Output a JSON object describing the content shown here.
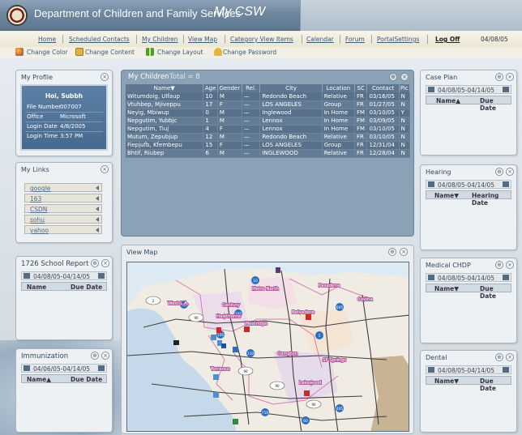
{
  "header": {
    "department": "Department of Children and Family Services",
    "app": "My CSW"
  },
  "nav": {
    "items": [
      "Home",
      "Scheduled Contacts",
      "My Children",
      "View Map",
      "Category View Items",
      "Calendar",
      "Forum",
      "PortalSettings",
      "Log Off"
    ],
    "date": "04/08/05"
  },
  "subnav": {
    "items": [
      "Change Color",
      "Change Content",
      "Change Layout",
      "Change Password"
    ]
  },
  "profile": {
    "title": "My Profile",
    "name": "Hoi, Subbh",
    "labels": [
      "File Number",
      "Office",
      "Login Date",
      "Login Time"
    ],
    "values": [
      "007007",
      "Microsoft",
      "4/8/2005",
      "3:57 PM"
    ]
  },
  "links": {
    "title": "My Links",
    "items": [
      "google",
      "163",
      "CSDN",
      "sohu",
      "yahoo"
    ]
  },
  "school_report": {
    "title": "1726 School Report",
    "range": "04/08/05-04/14/05",
    "col1": "Name",
    "col2": "Due Date"
  },
  "immunization": {
    "title": "Immunization",
    "range": "04/06/05-04/14/05",
    "col1": "Name▲",
    "col2": "Due Date"
  },
  "children": {
    "title": "My Children",
    "total": "Total = 8",
    "columns": [
      "Name▼",
      "Age",
      "Gender",
      "Rel.",
      "City",
      "Location",
      "SC",
      "Contact",
      "Pic"
    ],
    "rows": [
      [
        "Witumdoig, Ulfaup",
        "10",
        "M",
        "—",
        "Redondo Beach",
        "Relative",
        "FR",
        "03/16/05",
        "N"
      ],
      [
        "Vtuhbep, Mjiveppu",
        "17",
        "F",
        "—",
        "LOS ANGELES",
        "Group",
        "FR",
        "01/27/05",
        "N"
      ],
      [
        "Neyig, Mbiwup",
        "0",
        "M",
        "—",
        "Inglewood",
        "In Home",
        "FM",
        "03/10/05",
        "Y"
      ],
      [
        "Nepgutim, Yubbjc",
        "1",
        "M",
        "—",
        "Lennox",
        "In Home",
        "FM",
        "03/09/05",
        "N"
      ],
      [
        "Nepgutim, Tiuj",
        "4",
        "F",
        "—",
        "Lennox",
        "In Home",
        "FM",
        "03/10/05",
        "N"
      ],
      [
        "Mutum, Zepubjup",
        "12",
        "M",
        "—",
        "Redondo Beach",
        "Relative",
        "FR",
        "03/10/05",
        "N"
      ],
      [
        "Fiepjufb, Kfembepu",
        "15",
        "F",
        "—",
        "LOS ANGELES",
        "Group",
        "FR",
        "12/31/04",
        "N"
      ],
      [
        "Bhtif, Riubep",
        "6",
        "M",
        "—",
        "INGLEWOOD",
        "Relative",
        "FR",
        "12/28/04",
        "N"
      ]
    ]
  },
  "map": {
    "title": "View Map",
    "labels": [
      "Metro North",
      "Pasadena",
      "West L.A.",
      "Century",
      "Hawthorne",
      "Belvedere",
      "Westridge",
      "Covina",
      "Compton",
      "SF Springs",
      "Torrance",
      "Lakewood"
    ],
    "shields": [
      "10",
      "5",
      "605",
      "105",
      "110",
      "710",
      "405",
      "90",
      "2",
      "60"
    ]
  },
  "case_plan": {
    "title": "Case Plan",
    "range": "04/08/05-04/14/05",
    "col1": "Name▲",
    "col2": "Due Date"
  },
  "hearing": {
    "title": "Hearing",
    "range": "04/08/05-04/14/05",
    "col1": "Name▼",
    "col2": "Hearing Date"
  },
  "medical": {
    "title": "Medical CHDP",
    "range": "04/08/05-04/14/05",
    "col1": "Name▼",
    "col2": "Due Date"
  },
  "dental": {
    "title": "Dental",
    "range": "04/08/05-04/14/05",
    "col1": "Name▼",
    "col2": "Due Date"
  },
  "colors": {
    "accent": "#5d7790",
    "grid": "#8ba1b6",
    "map_bg": "#dde9f3"
  }
}
